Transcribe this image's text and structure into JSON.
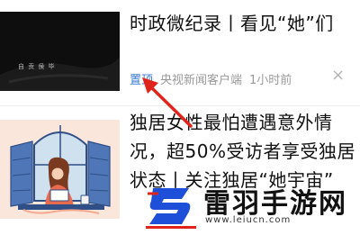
{
  "feed": [
    {
      "title": "时政微纪录丨看见“她”们",
      "pin_label": "置顶",
      "source": "央视新闻客户端",
      "time": "1小时前",
      "close_glyph": "×",
      "thumb_caption": "自 贡 侯 毕"
    },
    {
      "title": "独居女性最怕遭遇意外情况，超50%受访者享受独居状态丨关注独居“她宇宙”"
    }
  ],
  "watermark": {
    "text": "雷羽手游网",
    "url": "www.leiucn.com"
  },
  "colors": {
    "pin_blue": "#3c7bd6",
    "annotation_red": "#e0241c",
    "logo_blue": "#1d4fd8"
  }
}
